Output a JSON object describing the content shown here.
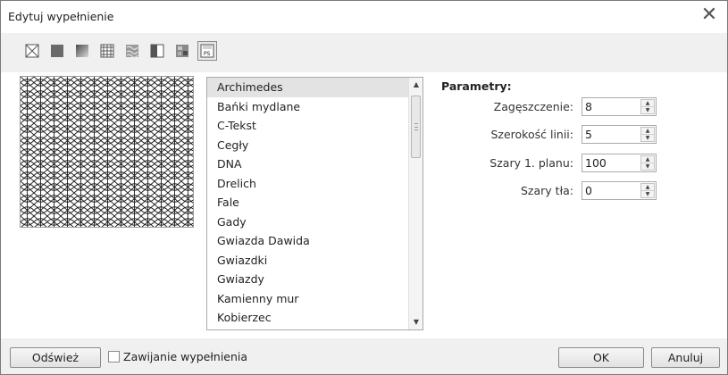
{
  "dialog": {
    "title": "Edytuj wypełnienie",
    "close_symbol": "✕"
  },
  "toolbar": {
    "tools": [
      {
        "icon": "no-fill-icon"
      },
      {
        "icon": "uniform-fill-icon"
      },
      {
        "icon": "fountain-fill-icon"
      },
      {
        "icon": "pattern-fill-icon"
      },
      {
        "icon": "texture-fill-icon"
      },
      {
        "icon": "two-color-fill-icon"
      },
      {
        "icon": "bitmap-fill-icon"
      },
      {
        "icon": "postscript-fill-icon",
        "active": true,
        "label": "PS"
      }
    ]
  },
  "pattern_list": {
    "items": [
      "Archimedes",
      "Bańki mydlane",
      "C-Tekst",
      "Cegły",
      "DNA",
      "Drelich",
      "Fale",
      "Gady",
      "Gwiazda Dawida",
      "Gwiazdki",
      "Gwiazdy",
      "Kamienny mur",
      "Kobierzec"
    ],
    "selected": "Archimedes"
  },
  "parameters": {
    "heading": "Parametry:",
    "fields": [
      {
        "label": "Zagęszczenie:",
        "value": "8"
      },
      {
        "label": "Szerokość linii:",
        "value": "5"
      },
      {
        "label": "Szary 1. planu:",
        "value": "100"
      },
      {
        "label": "Szary tła:",
        "value": "0"
      }
    ]
  },
  "footer": {
    "refresh_label": "Odśwież",
    "wrap_fill_label": "Zawijanie wypełnienia",
    "wrap_fill_checked": false,
    "ok_label": "OK",
    "cancel_label": "Anuluj"
  }
}
